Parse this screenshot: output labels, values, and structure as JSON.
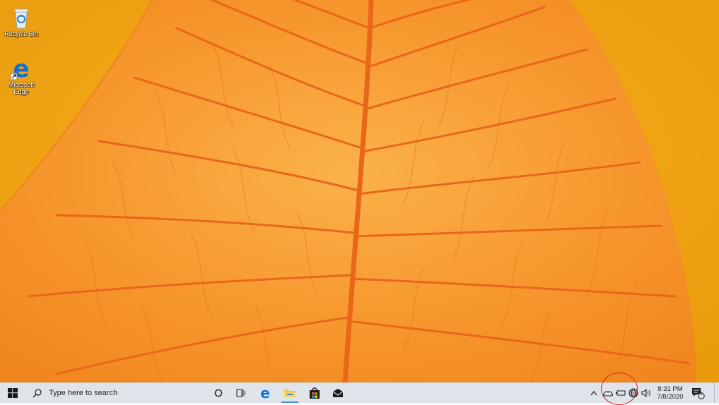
{
  "desktop": {
    "icons": [
      {
        "name": "recycle-bin",
        "label": "Recycle Bin"
      },
      {
        "name": "microsoft-edge",
        "label": "Microsoft Edge"
      }
    ]
  },
  "taskbar": {
    "start_icon": "windows-logo-icon",
    "search": {
      "placeholder": "Type here to search",
      "icon": "search-icon"
    },
    "pinned": [
      {
        "name": "cortana",
        "icon": "circle-icon"
      },
      {
        "name": "task-view",
        "icon": "task-view-icon"
      },
      {
        "name": "edge",
        "icon": "edge-icon"
      },
      {
        "name": "file-explorer",
        "icon": "folder-icon"
      },
      {
        "name": "store",
        "icon": "store-bag-icon"
      },
      {
        "name": "mail",
        "icon": "mail-icon"
      }
    ],
    "tray": {
      "icons": [
        "chevron-up-icon",
        "onedrive-cloud-icon",
        "battery-icon",
        "globe-icon",
        "speaker-icon"
      ],
      "chevron_glyph": "^"
    },
    "clock": {
      "time": "8:31 PM",
      "date": "7/8/2020"
    },
    "notifications": {
      "count": "1",
      "icon": "action-center-icon"
    }
  },
  "colors": {
    "wallpaper_base": "#f4a010",
    "leaf": "#f08a18",
    "veins": "#e8671a",
    "taskbar": "#dfe4ea",
    "edge_blue": "#0f6fd6",
    "annotation": "#e0201e"
  }
}
